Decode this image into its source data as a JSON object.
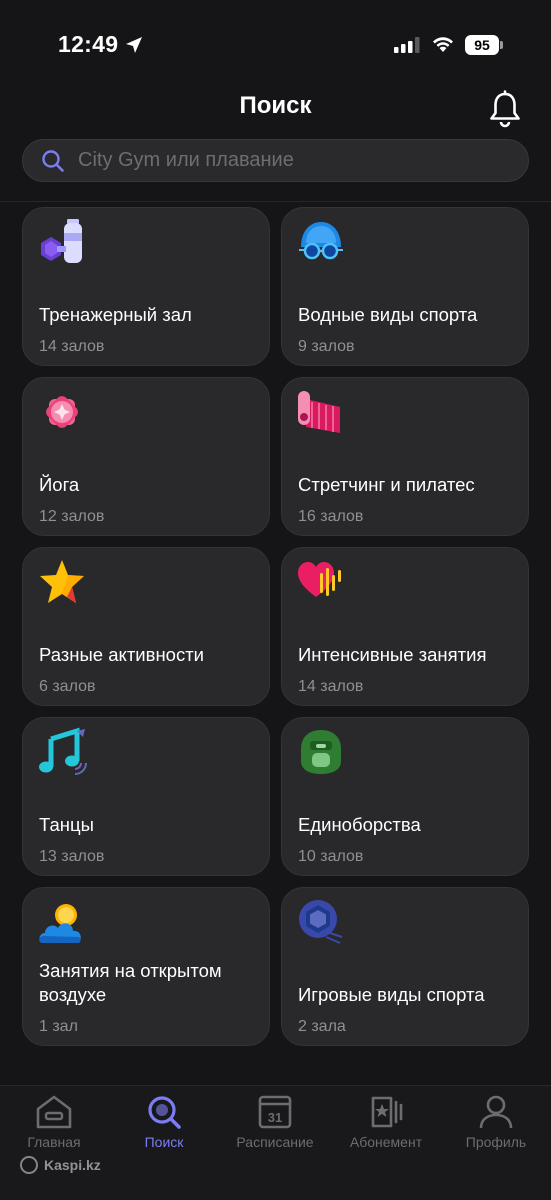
{
  "status_bar": {
    "time": "12:49",
    "battery": "95"
  },
  "header": {
    "title": "Поиск"
  },
  "search": {
    "placeholder": "City Gym или плавание"
  },
  "categories": [
    {
      "title": "Тренажерный зал",
      "count": "14 залов",
      "icon": "gym-equipment-icon"
    },
    {
      "title": "Водные виды спорта",
      "count": "9 залов",
      "icon": "swim-cap-icon"
    },
    {
      "title": "Йога",
      "count": "12 залов",
      "icon": "lotus-icon"
    },
    {
      "title": "Стретчинг и пилатес",
      "count": "16 залов",
      "icon": "yoga-mat-icon"
    },
    {
      "title": "Разные активности",
      "count": "6 залов",
      "icon": "star-icon"
    },
    {
      "title": "Интенсивные занятия",
      "count": "14 залов",
      "icon": "heart-pulse-icon"
    },
    {
      "title": "Танцы",
      "count": "13 залов",
      "icon": "music-note-icon"
    },
    {
      "title": "Единоборства",
      "count": "10 залов",
      "icon": "boxing-helmet-icon"
    },
    {
      "title": "Занятия на открытом воздухе",
      "count": "1 зал",
      "icon": "sun-cloud-icon"
    },
    {
      "title": "Игровые виды спорта",
      "count": "2 зала",
      "icon": "ball-icon"
    }
  ],
  "tabbar": {
    "items": [
      {
        "label": "Главная",
        "icon": "home-icon"
      },
      {
        "label": "Поиск",
        "icon": "search-icon"
      },
      {
        "label": "Расписание",
        "icon": "calendar-icon",
        "calendar_day": "31"
      },
      {
        "label": "Абонемент",
        "icon": "pass-icon"
      },
      {
        "label": "Профиль",
        "icon": "profile-icon"
      }
    ],
    "active": "Поиск"
  },
  "watermark": {
    "text": "Kaspi.kz"
  },
  "colors": {
    "background": "#151517",
    "card": "#29292c",
    "accent": "#7c7cf4",
    "muted_text": "#8f8f94"
  }
}
